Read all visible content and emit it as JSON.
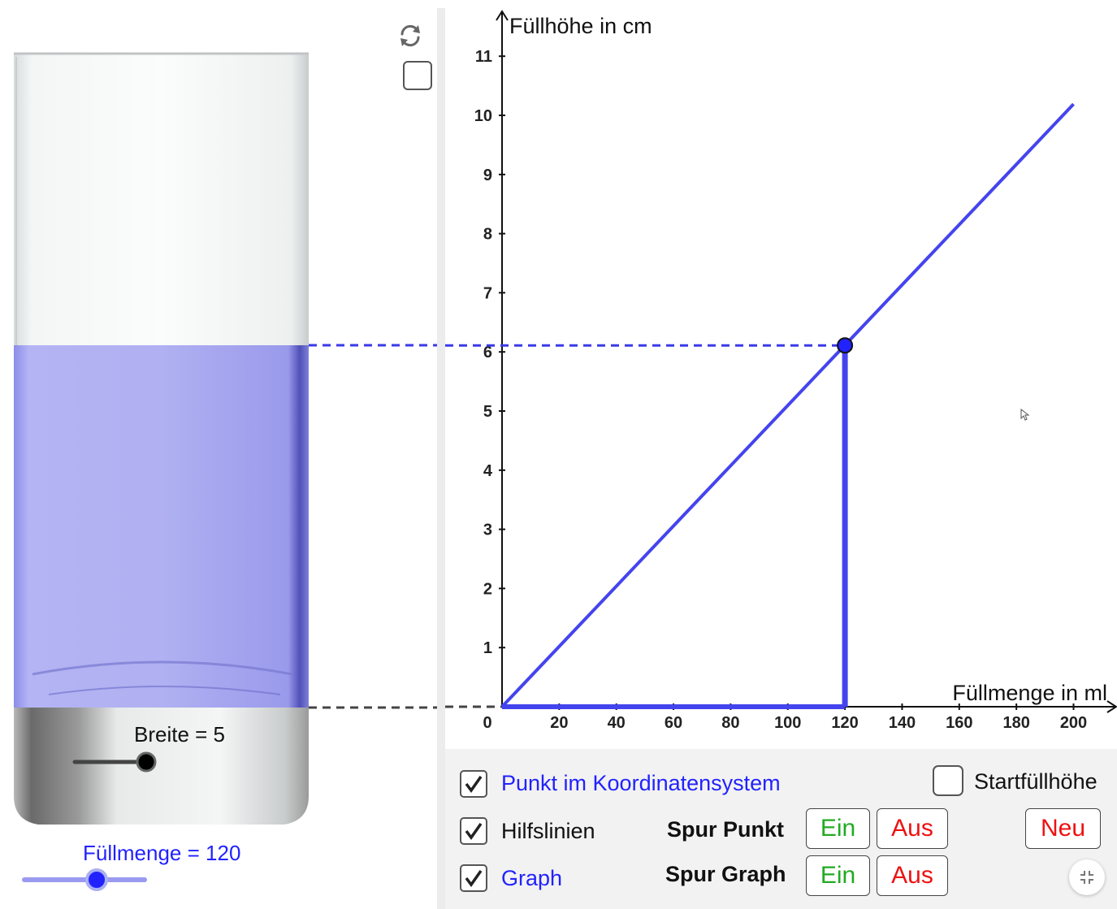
{
  "left_panel": {
    "breite_label": "Breite = 5",
    "fuellmenge_label": "Füllmenge = 120"
  },
  "colors": {
    "accent": "#2222ff",
    "graph_line": "#4444ee",
    "water": "#9999ee",
    "green_button": "#22aa22",
    "red_button": "#ee1111"
  },
  "icons": {
    "reset": "reset-icon",
    "collapse": "collapse-icon",
    "mouse_cursor": "mouse-cursor-icon"
  },
  "chart_data": {
    "type": "line",
    "xlabel": "Füllmenge in ml",
    "ylabel": "Füllhöhe in cm",
    "x_ticks": [
      "0",
      "20",
      "40",
      "60",
      "80",
      "100",
      "120",
      "140",
      "160",
      "180",
      "200"
    ],
    "y_ticks": [
      "1",
      "2",
      "3",
      "4",
      "5",
      "6",
      "7",
      "8",
      "9",
      "10",
      "11"
    ],
    "xlim": [
      0,
      215
    ],
    "ylim": [
      0,
      11.5
    ],
    "grid": false,
    "series": [
      {
        "x": [
          0,
          200
        ],
        "y": [
          0,
          10.19
        ]
      }
    ],
    "point": {
      "x": 120,
      "y": 6.11
    },
    "helper_lines": {
      "from_point_to_x_axis": true,
      "from_point_to_y_axis": true,
      "dashed": true
    }
  },
  "controls": {
    "punkt_checkbox": {
      "label": "Punkt im Koordinatensystem",
      "checked": true
    },
    "hilfslinien_checkbox": {
      "label": "Hilfslinien",
      "checked": true
    },
    "graph_checkbox": {
      "label": "Graph",
      "checked": true
    },
    "startfuellhoehe_checkbox": {
      "label": "Startfüllhöhe",
      "checked": false
    },
    "spur_punkt": {
      "label": "Spur Punkt",
      "ein": "Ein",
      "aus": "Aus"
    },
    "spur_graph": {
      "label": "Spur Graph",
      "ein": "Ein",
      "aus": "Aus"
    },
    "neu_button": "Neu"
  },
  "sliders": {
    "breite": {
      "value": 5
    },
    "fuellmenge": {
      "value": 120
    }
  }
}
